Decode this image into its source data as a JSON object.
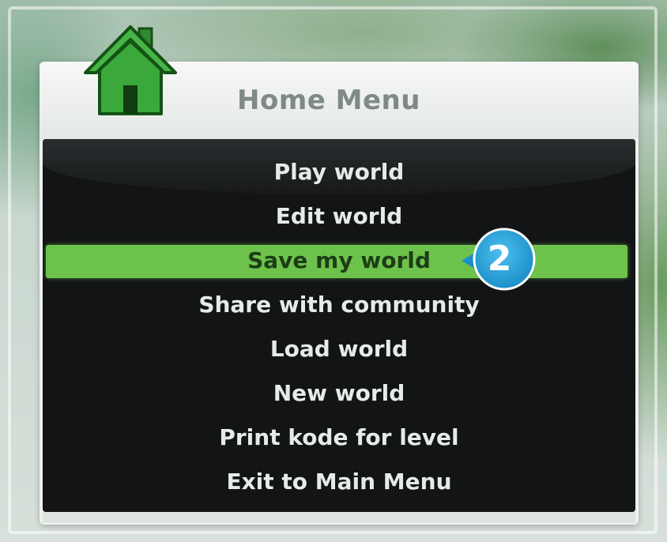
{
  "header": {
    "title": "Home Menu",
    "icon": "home-icon"
  },
  "menu": {
    "items": [
      {
        "label": "Play world",
        "selected": false
      },
      {
        "label": "Edit world",
        "selected": false
      },
      {
        "label": "Save my world",
        "selected": true
      },
      {
        "label": "Share with community",
        "selected": false
      },
      {
        "label": "Load world",
        "selected": false
      },
      {
        "label": "New world",
        "selected": false
      },
      {
        "label": "Print kode for level",
        "selected": false
      },
      {
        "label": "Exit to Main Menu",
        "selected": false
      }
    ]
  },
  "callout": {
    "number": "2",
    "color": "#2aa8e0"
  },
  "colors": {
    "highlight": "#6dc24b",
    "menu_bg": "#121415",
    "home_icon": "#3aa83a"
  }
}
